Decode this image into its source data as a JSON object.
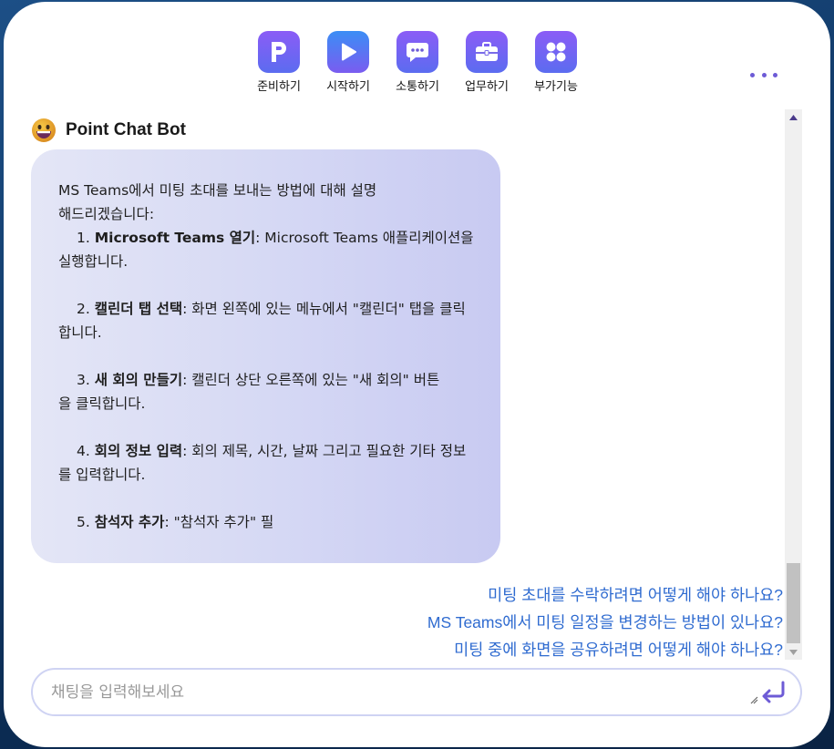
{
  "toolbar": {
    "items": [
      {
        "label": "준비하기",
        "icon": "p-letter-icon"
      },
      {
        "label": "시작하기",
        "icon": "play-icon"
      },
      {
        "label": "소통하기",
        "icon": "chat-bubble-icon"
      },
      {
        "label": "업무하기",
        "icon": "briefcase-icon"
      },
      {
        "label": "부가기능",
        "icon": "grid-icon"
      }
    ],
    "more_icon": "more-dots-icon"
  },
  "bot": {
    "name": "Point Chat Bot",
    "avatar_icon": "grinning-face-icon"
  },
  "message": {
    "intro": "MS Teams에서 미팅 초대를 보내는 방법에 대해 설명해드리겠습니다:",
    "steps": [
      {
        "num": "1.",
        "title": "Microsoft Teams 열기",
        "text": ": Microsoft Teams 애플리케이션을 실행합니다."
      },
      {
        "num": "2.",
        "title": "캘린더 탭 선택",
        "text": ": 화면 왼쪽에 있는 메뉴에서 \"캘린더\" 탭을 클릭합니다."
      },
      {
        "num": "3.",
        "title": "새 회의 만들기",
        "text": ": 캘린더 상단 오른쪽에 있는 \"새 회의\" 버튼을 클릭합니다."
      },
      {
        "num": "4.",
        "title": "회의 정보 입력",
        "text": ": 회의 제목, 시간, 날짜 그리고 필요한 기타 정보를 입력합니다."
      },
      {
        "num": "5.",
        "title": "참석자 추가",
        "text": ": \"참석자 추가\" 필"
      }
    ]
  },
  "suggestions": [
    "미팅 초대를 수락하려면 어떻게 해야 하나요?",
    "MS Teams에서 미팅 일정을 변경하는 방법이 있나요?",
    "미팅 중에 화면을 공유하려면 어떻게 해야 하나요?"
  ],
  "input": {
    "placeholder": "채팅을 입력해보세요",
    "value": ""
  },
  "colors": {
    "accent": "#6d5bd6",
    "link": "#2f6bd0",
    "bubble_start": "#e4e6f6",
    "bubble_end": "#c8caf2"
  }
}
